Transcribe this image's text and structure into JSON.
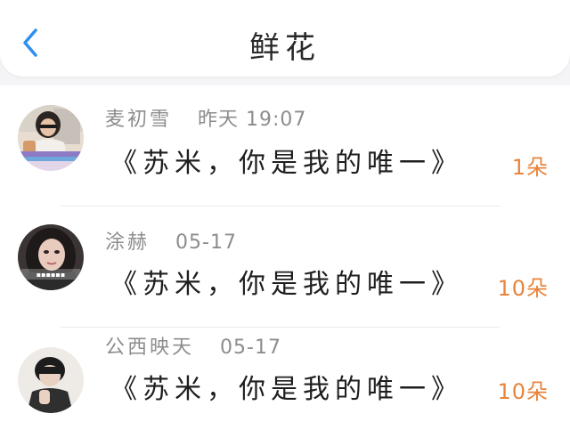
{
  "header": {
    "title": "鲜花"
  },
  "icons": {
    "back": "chevron-left-icon"
  },
  "colors": {
    "accent": "#2f8ff0",
    "count": "#e9843c",
    "background": "#f4f4f6"
  },
  "gifts": [
    {
      "name": "麦初雪",
      "time": "昨天 19:07",
      "message": "《苏米，你是我的唯一》",
      "count": "1朵"
    },
    {
      "name": "涂赫",
      "time": "05-17",
      "message": "《苏米，你是我的唯一》",
      "count": "10朵"
    },
    {
      "name": "公西映天",
      "time": "05-17",
      "message": "《苏米，你是我的唯一》",
      "count": "10朵"
    }
  ]
}
